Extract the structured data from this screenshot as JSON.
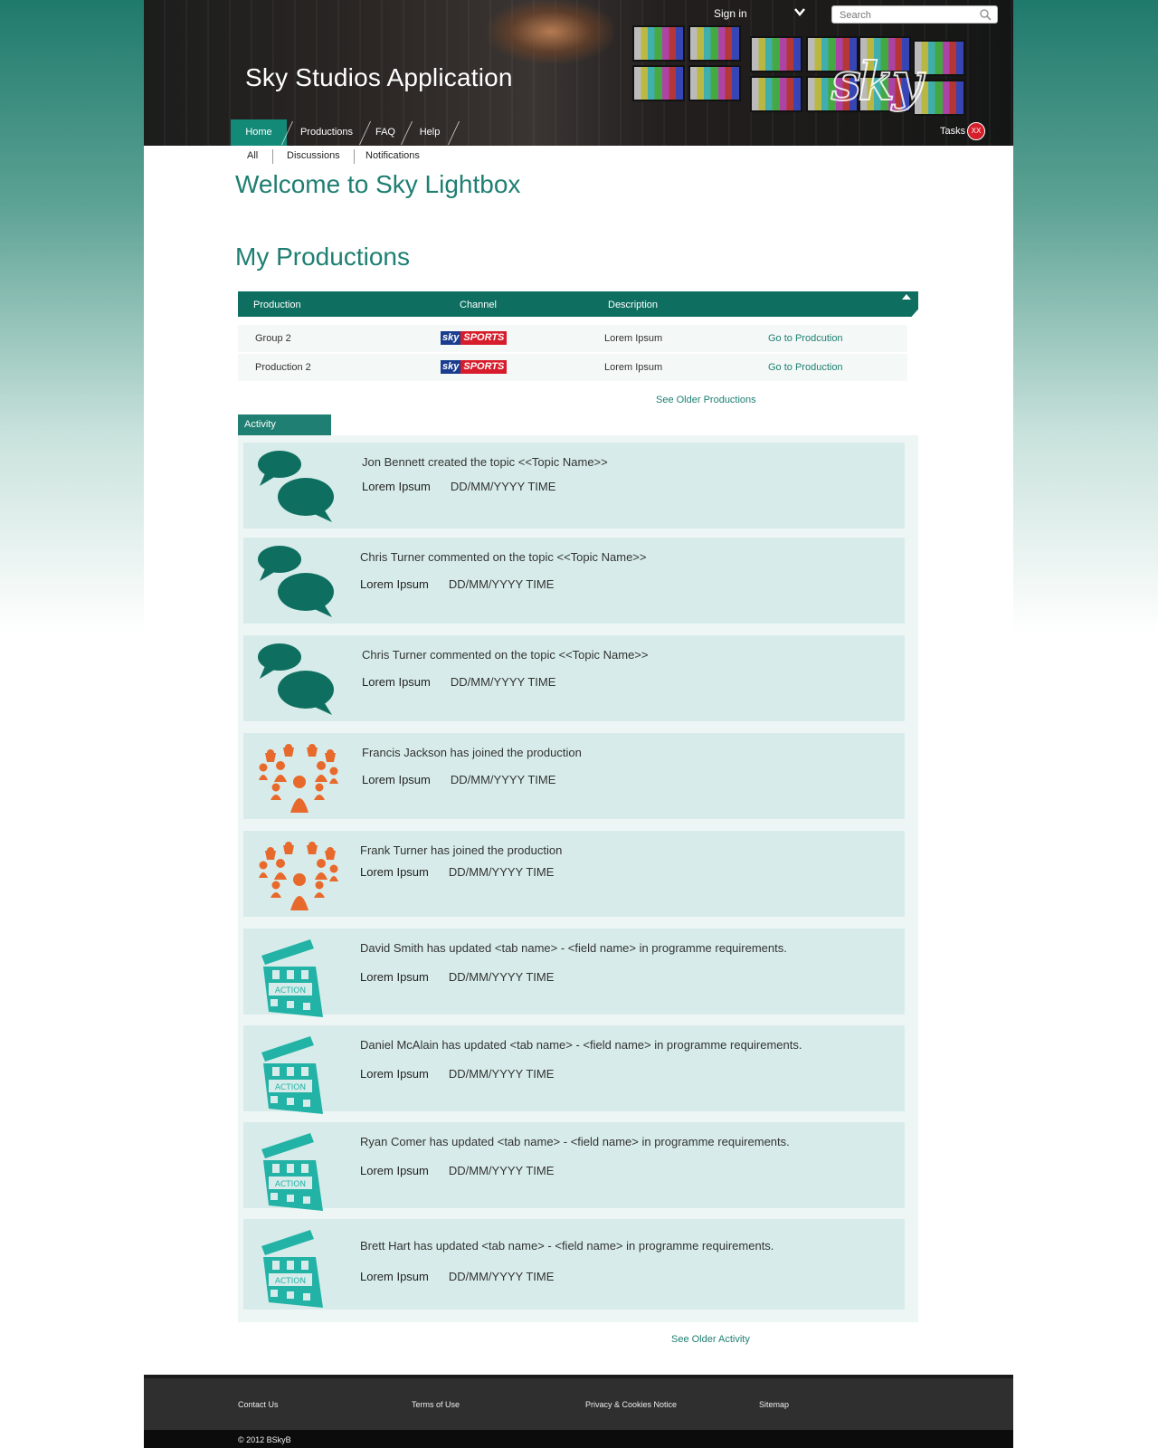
{
  "header": {
    "app_title": "Sky Studios Application",
    "logo_text": "sky",
    "signin_label": "Sign in",
    "search_placeholder": "Search",
    "tasks_label": "Tasks",
    "tasks_badge": "XX"
  },
  "nav": {
    "tabs": [
      {
        "label": "Home",
        "active": true
      },
      {
        "label": "Productions",
        "active": false
      },
      {
        "label": "FAQ",
        "active": false
      },
      {
        "label": "Help",
        "active": false
      }
    ]
  },
  "subnav": {
    "items": [
      "All",
      "Discussions",
      "Notifications"
    ]
  },
  "welcome_title": "Welcome to Sky Lightbox",
  "productions": {
    "title": "My Productions",
    "columns": [
      "Production",
      "Channel",
      "Description"
    ],
    "rows": [
      {
        "name": "Group 2",
        "channel_logo": [
          "sky",
          "SPORTS"
        ],
        "description": "Lorem Ipsum",
        "link": "Go to Prodcution"
      },
      {
        "name": "Production 2",
        "channel_logo": [
          "sky",
          "SPORTS"
        ],
        "description": "Lorem Ipsum",
        "link": "Go to Production"
      }
    ],
    "see_older": "See Older Productions"
  },
  "activity": {
    "tab_label": "Activity",
    "items": [
      {
        "icon": "speech-bubbles-icon",
        "text": "Jon Bennett created the topic <<Topic Name>>",
        "sub": "Lorem Ipsum",
        "date": "DD/MM/YYYY TIME"
      },
      {
        "icon": "speech-bubbles-icon",
        "text": "Chris Turner commented on the topic <<Topic Name>>",
        "sub": "Lorem Ipsum",
        "date": "DD/MM/YYYY TIME"
      },
      {
        "icon": "speech-bubbles-icon",
        "text": "Chris Turner commented on the topic <<Topic Name>>",
        "sub": "Lorem Ipsum",
        "date": "DD/MM/YYYY TIME"
      },
      {
        "icon": "people-group-icon",
        "text": "Francis Jackson has joined the production",
        "sub": "Lorem Ipsum",
        "date": "DD/MM/YYYY TIME"
      },
      {
        "icon": "people-group-icon",
        "text": "Frank Turner has joined the production",
        "sub": "Lorem Ipsum",
        "date": "DD/MM/YYYY TIME"
      },
      {
        "icon": "clapperboard-icon",
        "text": "David Smith has updated <tab name> - <field name> in programme requirements.",
        "sub": "Lorem Ipsum",
        "date": "DD/MM/YYYY TIME"
      },
      {
        "icon": "clapperboard-icon",
        "text": "Daniel McAlain has updated <tab name> - <field name> in programme requirements.",
        "sub": "Lorem Ipsum",
        "date": "DD/MM/YYYY TIME"
      },
      {
        "icon": "clapperboard-icon",
        "text": "Ryan Comer has updated <tab name> - <field name> in programme requirements.",
        "sub": "Lorem Ipsum",
        "date": "DD/MM/YYYY TIME"
      },
      {
        "icon": "clapperboard-icon",
        "text": "Brett Hart has updated <tab name> - <field name> in programme requirements.",
        "sub": "Lorem Ipsum",
        "date": "DD/MM/YYYY TIME"
      }
    ],
    "clapper_text": "ACTION",
    "see_older": "See Older Activity"
  },
  "footer": {
    "links": [
      "Contact Us",
      "Terms of Use",
      "Privacy & Cookies Notice",
      "Sitemap"
    ],
    "copyright": "© 2012 BSkyB"
  },
  "colors": {
    "brand_teal": "#1e7f72",
    "header_teal": "#0e6f60",
    "activity_bg": "#d7ecea",
    "orange": "#e8692c",
    "clapper_teal": "#23b3a6"
  }
}
